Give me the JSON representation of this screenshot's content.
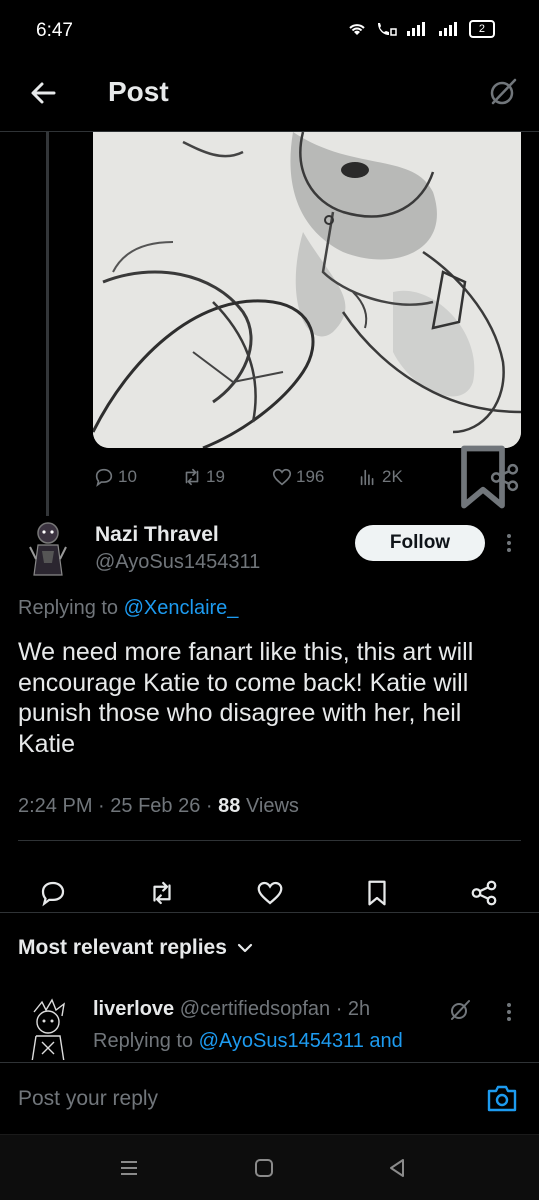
{
  "status_bar": {
    "time": "6:47",
    "battery": "2",
    "icons": [
      "wifi-icon",
      "volte-call-icon",
      "signal-icon",
      "signal-icon",
      "battery-icon"
    ]
  },
  "app_bar": {
    "title": "Post",
    "back_icon": "arrow-left-icon",
    "grok_icon": "grok-icon"
  },
  "parent_post": {
    "image": "sketch-artwork",
    "actions": {
      "replies": "10",
      "reposts": "19",
      "likes": "196",
      "views": "2K"
    }
  },
  "reply": {
    "author_name": "Nazi Thravel",
    "author_handle": "@AyoSus1454311",
    "follow_label": "Follow",
    "replying_prefix": "Replying to",
    "replying_to": "@Xenclaire_",
    "text": "We need more fanart like this, this art will encourage Katie to come back! Katie will punish those who disagree with her, heil Katie",
    "time": "2:24 PM",
    "date": "25 Feb 26",
    "views_count": "88",
    "views_label": "Views"
  },
  "sort": {
    "label": "Most relevant replies"
  },
  "next_reply": {
    "author_name": "liverlove",
    "author_handle": "@certifiedsopfan",
    "age": "2h",
    "replying_prefix": "Replying to",
    "replying_to": "@AyoSus1454311 and"
  },
  "composer": {
    "placeholder": "Post your reply"
  },
  "colors": {
    "background": "#000000",
    "text_primary": "#e7e9ea",
    "text_secondary": "#71767b",
    "accent": "#1d9bf0",
    "divider": "#2f3336"
  }
}
